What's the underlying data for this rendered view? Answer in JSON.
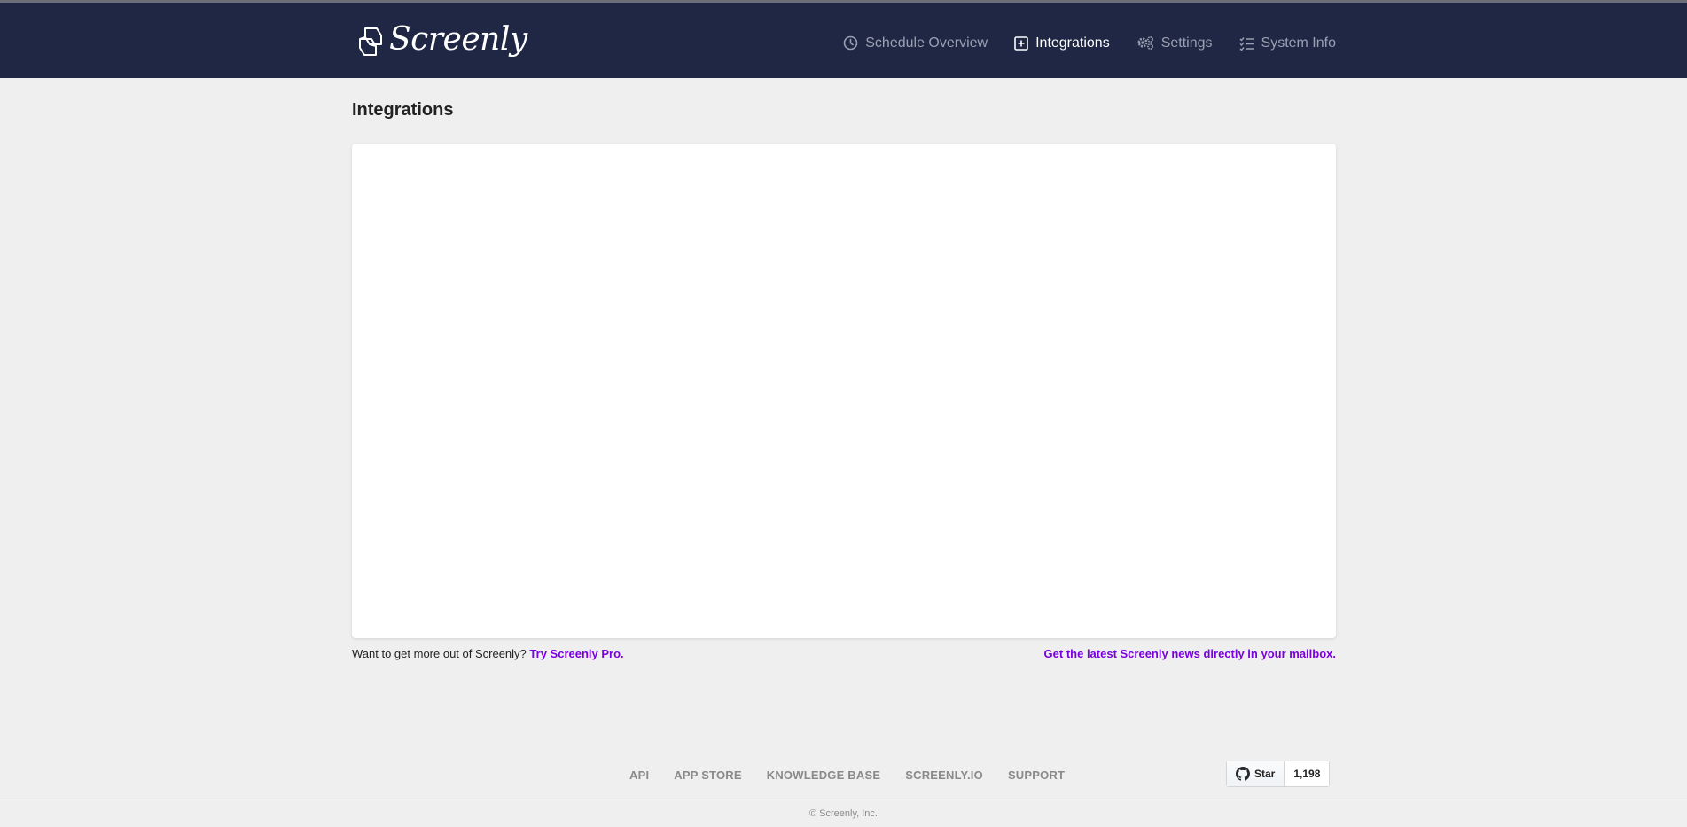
{
  "brand": {
    "name": "Screenly"
  },
  "nav": {
    "items": [
      {
        "label": "Schedule Overview",
        "icon": "clock-icon",
        "active": false
      },
      {
        "label": "Integrations",
        "icon": "plus-square-icon",
        "active": true
      },
      {
        "label": "Settings",
        "icon": "gears-icon",
        "active": false
      },
      {
        "label": "System Info",
        "icon": "list-check-icon",
        "active": false
      }
    ]
  },
  "page": {
    "title": "Integrations"
  },
  "promo": {
    "left_text": "Want to get more out of Screenly?",
    "left_link": "Try Screenly Pro.",
    "right_link": "Get the latest Screenly news directly in your mailbox."
  },
  "footer": {
    "links": [
      "API",
      "APP STORE",
      "KNOWLEDGE BASE",
      "SCREENLY.IO",
      "SUPPORT"
    ],
    "github": {
      "star_label": "Star",
      "count": "1,198",
      "icon": "github-icon"
    },
    "copyright": "© Screenly, Inc."
  },
  "colors": {
    "navbar": "#1f2744",
    "background": "#efefef",
    "link_accent": "#7a00e0",
    "nav_inactive": "#9aa0b1",
    "nav_active": "#ffffff"
  }
}
